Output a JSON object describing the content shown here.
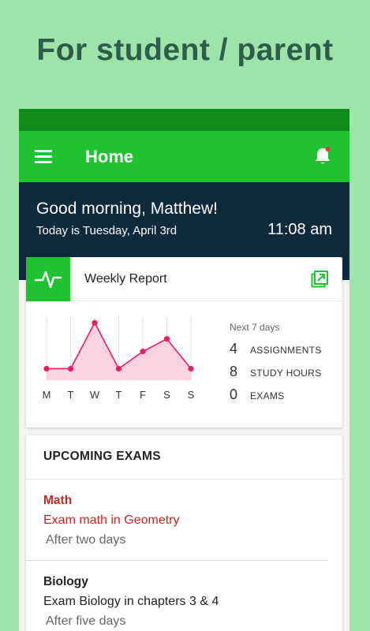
{
  "promo": {
    "title": "For student / parent"
  },
  "app_bar": {
    "title": "Home",
    "icons": [
      "menu-icon",
      "bell-icon"
    ],
    "notification_dot_color": "#e53935"
  },
  "greeting": {
    "message": "Good morning, Matthew!",
    "date": "Today is Tuesday, April 3rd",
    "time": "11:08 am"
  },
  "weekly_report": {
    "title": "Weekly Report",
    "icons": [
      "pulse-icon",
      "open-external-icon"
    ],
    "next_label": "Next 7 days",
    "stats": [
      {
        "value": "4",
        "label": "ASSIGNMENTS"
      },
      {
        "value": "8",
        "label": "STUDY HOURS"
      },
      {
        "value": "0",
        "label": "EXAMS"
      }
    ]
  },
  "chart_data": {
    "type": "area",
    "categories": [
      "M",
      "T",
      "W",
      "T",
      "F",
      "S",
      "S"
    ],
    "values": [
      1,
      1,
      5,
      1,
      2.5,
      3.6,
      1
    ],
    "ylim": [
      0,
      5.5
    ],
    "grid": "vertical",
    "color": "#e91e63",
    "fill": "#fbd3e0"
  },
  "exams": {
    "heading": "UPCOMING EXAMS",
    "items": [
      {
        "subject": "Math",
        "description": "Exam math in Geometry",
        "when": "After two days",
        "color": "#c62828"
      },
      {
        "subject": "Biology",
        "description": "Exam Biology in chapters 3 & 4",
        "when": "After five days",
        "color": "#222222"
      }
    ]
  },
  "colors": {
    "background": "#9ee3a9",
    "app_bar": "#21c231",
    "status_bar": "#0f8a1b",
    "greeting_bg": "#0d2b3d"
  }
}
